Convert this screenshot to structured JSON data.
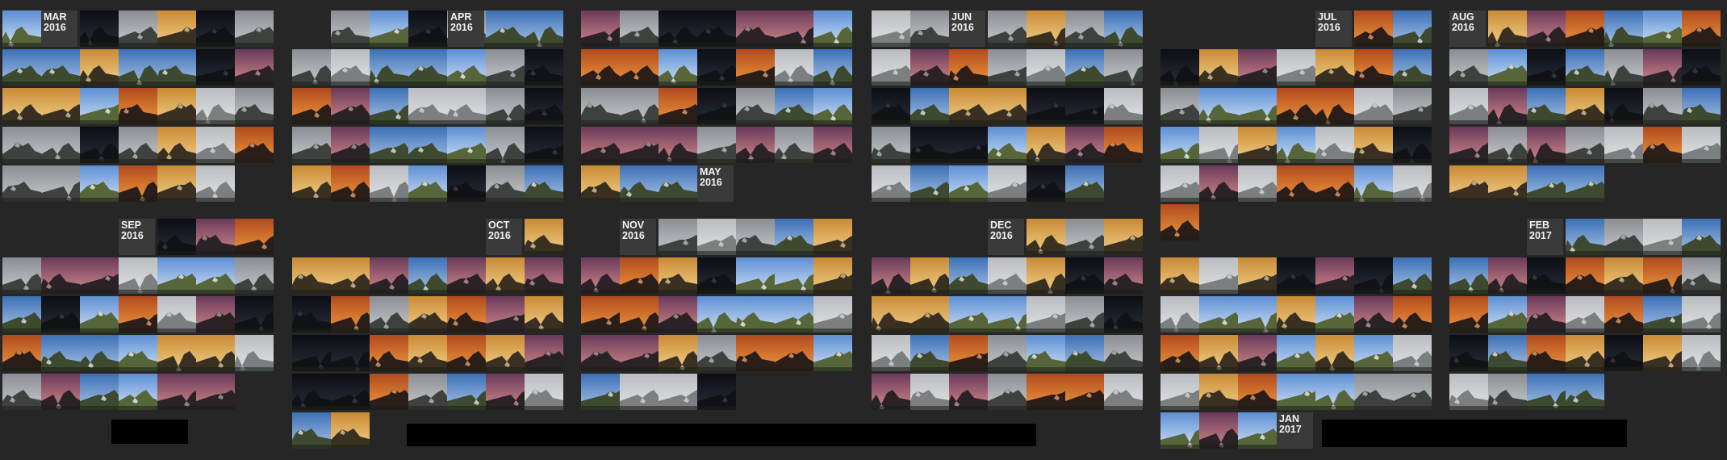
{
  "months": [
    {
      "label": "MAR",
      "year": "2016"
    },
    {
      "label": "APR",
      "year": "2016"
    },
    {
      "label": "MAY",
      "year": "2016"
    },
    {
      "label": "JUN",
      "year": "2016"
    },
    {
      "label": "JUL",
      "year": "2016"
    },
    {
      "label": "AUG",
      "year": "2016"
    },
    {
      "label": "SEP",
      "year": "2016"
    },
    {
      "label": "OCT",
      "year": "2016"
    },
    {
      "label": "NOV",
      "year": "2016"
    },
    {
      "label": "DEC",
      "year": "2016"
    },
    {
      "label": "JAN",
      "year": "2017"
    },
    {
      "label": "FEB",
      "year": "2017"
    }
  ],
  "palette": {
    "background": "#262626",
    "label_box": "#3a3a3a",
    "label_text": "#f2f2f2",
    "redaction": "#000000"
  },
  "thumbnail_subject": "mountain-photo",
  "sky_moods": [
    "clear-blue",
    "golden-sunset",
    "overcast-grey",
    "night-dark",
    "misty",
    "pink-dusk",
    "sunrise-orange",
    "bright-day"
  ]
}
